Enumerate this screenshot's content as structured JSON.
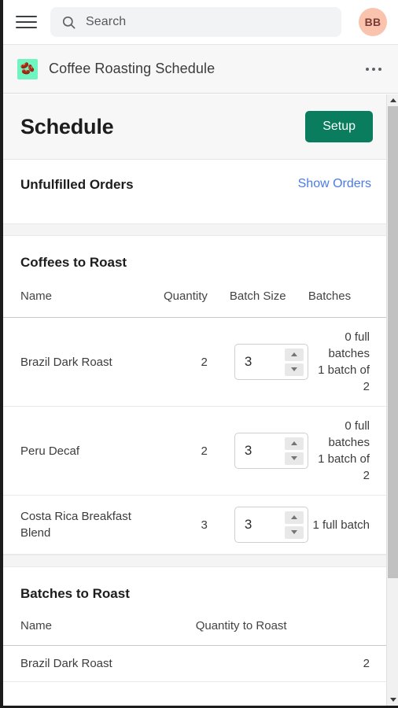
{
  "topbar": {
    "menu_icon": "hamburger-menu-icon",
    "search": {
      "icon": "search-icon",
      "placeholder": "Search",
      "value": ""
    },
    "avatar": {
      "initials": "BB",
      "bg_color": "#f9c3ae",
      "text_color": "#7d3b36"
    }
  },
  "appbar": {
    "icon_glyph": "🫘",
    "icon_bg": "#6ff5c0",
    "title": "Coffee Roasting Schedule",
    "overflow_label": "•••"
  },
  "schedule": {
    "title": "Schedule",
    "setup_button": "Setup",
    "setup_color": "#0a7d5e"
  },
  "unfulfilled": {
    "title": "Unfulfilled Orders",
    "link": "Show Orders",
    "link_color": "#4a7be4"
  },
  "coffees_section": {
    "title": "Coffees to Roast",
    "columns": [
      "Name",
      "Quantity",
      "Batch Size",
      "Batches"
    ],
    "rows": [
      {
        "name": "Brazil Dark Roast",
        "quantity": "2",
        "batch_size": "3",
        "batches_line1": "0 full batches",
        "batches_line2": "1 batch of 2"
      },
      {
        "name": "Peru Decaf",
        "quantity": "2",
        "batch_size": "3",
        "batches_line1": "0 full batches",
        "batches_line2": "1 batch of 2"
      },
      {
        "name": "Costa Rica Breakfast Blend",
        "quantity": "3",
        "batch_size": "3",
        "batches_line1": "1 full batch",
        "batches_line2": ""
      }
    ]
  },
  "batches_section": {
    "title": "Batches to Roast",
    "columns": [
      "Name",
      "Quantity to Roast"
    ],
    "rows": [
      {
        "name": "Brazil Dark Roast",
        "quantity": "2"
      }
    ]
  },
  "scrollbar": {
    "up_icon": "scroll-up-arrow-icon",
    "down_icon": "scroll-down-arrow-icon"
  }
}
